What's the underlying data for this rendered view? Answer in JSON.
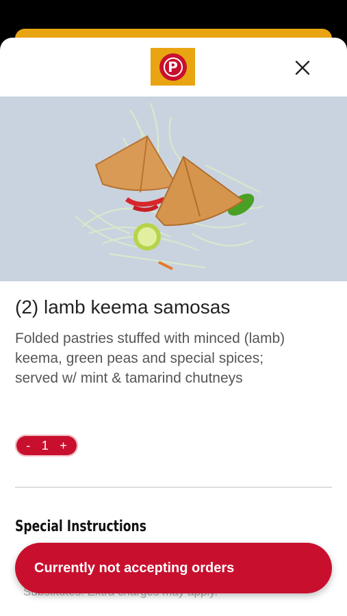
{
  "brand": {
    "logo_letter": "P",
    "accent": "#c8102e",
    "logo_bg": "#e9a411"
  },
  "item": {
    "title": "(2) lamb keema samosas",
    "description": "Folded pastries stuffed with minced (lamb) keema, green peas and special spices;\n served w/ mint & tamarind chutneys"
  },
  "quantity": {
    "minus": "-",
    "value": "1",
    "plus": "+"
  },
  "special_instructions": {
    "title": "Special Instructions",
    "hint": "Substitutes. Extra charges may apply."
  },
  "order_button": {
    "label": "Currently not accepting orders"
  },
  "icons": {
    "close": "close-icon"
  }
}
